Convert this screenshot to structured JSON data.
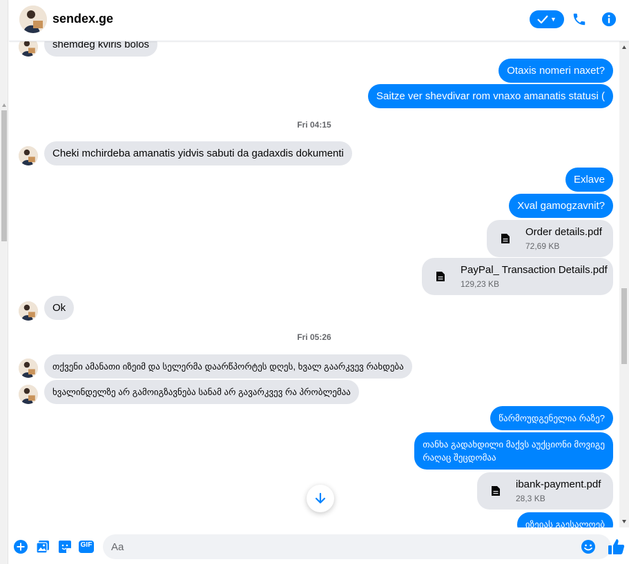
{
  "header": {
    "title": "sendex.ge",
    "icons": [
      "check-icon",
      "chevron-down-icon",
      "phone-icon",
      "info-icon"
    ]
  },
  "colors": {
    "accent": "#0084ff",
    "incoming": "#e4e6eb",
    "outgoing": "#0084ff"
  },
  "messages": {
    "m1": "shemdeg kviris bolos",
    "m2": "Otaxis nomeri naxet?",
    "m3": "Saitze ver shevdivar rom vnaxo amanatis statusi (",
    "ts1": "Fri 04:15",
    "m4": "Cheki mchirdeba amanatis yidvis sabuti da gadaxdis dokumenti",
    "m5": "Exlave",
    "m6": "Xval gamogzavnit?",
    "f1": {
      "name": "Order details.pdf",
      "size": "72,69 KB"
    },
    "f2": {
      "name": "PayPal_ Transaction Details.pdf",
      "size": "129,23 KB"
    },
    "m7": "Ok",
    "ts2": "Fri 05:26",
    "m8": "თქვენი ამანათი იზეიმ და სელერმა დაარწპორტეს დღეს, ხვალ გაარკვევ რახდება",
    "m9": "ხვალინდელზე არ გამოიგზავნება სანამ არ გავარკვევ რა პრობლემაა",
    "m10": "წარმოუდგენელია რაზე?",
    "m11a": "თანხა გადახდილი მაქვს აუქციონი მოვიგე",
    "m11b": "რაღაც შეცდომაა",
    "f3": {
      "name": "ibank-payment.pdf",
      "size": "28,3 KB"
    },
    "m12": "იზეიას გაესალოებ"
  },
  "composer": {
    "placeholder": "Aa",
    "icons": [
      "plus-icon",
      "image-icon",
      "sticker-icon",
      "gif-icon",
      "emoji-icon",
      "like-icon"
    ],
    "gif_label": "GIF"
  }
}
